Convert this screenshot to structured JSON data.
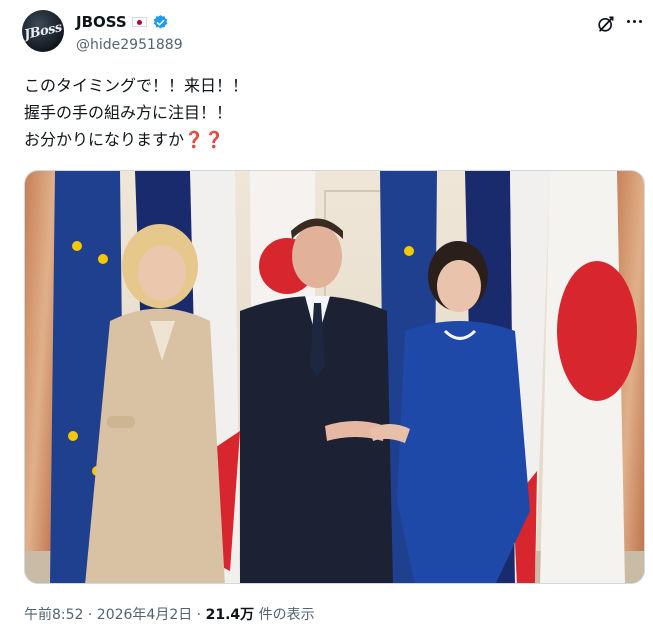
{
  "author": {
    "display_name": "JBOSS",
    "handle": "@hide2951889",
    "avatar_text": "JBoss",
    "verified": true,
    "flag_icon": "japan-flag-icon"
  },
  "tweet": {
    "lines": [
      "このタイミングで！！来日！！",
      "握手の手の組み方に注目！！",
      "お分かりになりますか"
    ],
    "emoji": "❓❓"
  },
  "media": {
    "description_icons": [
      "eu-flag",
      "france-flag",
      "japan-flag"
    ]
  },
  "meta": {
    "time_date": "午前8:52 · 2026年4月2日 · ",
    "views_count": "21.4万",
    "views_label": " 件の表示"
  },
  "colors": {
    "verified": "#1d9bf0",
    "text": "#0f1419",
    "muted": "#536471"
  }
}
